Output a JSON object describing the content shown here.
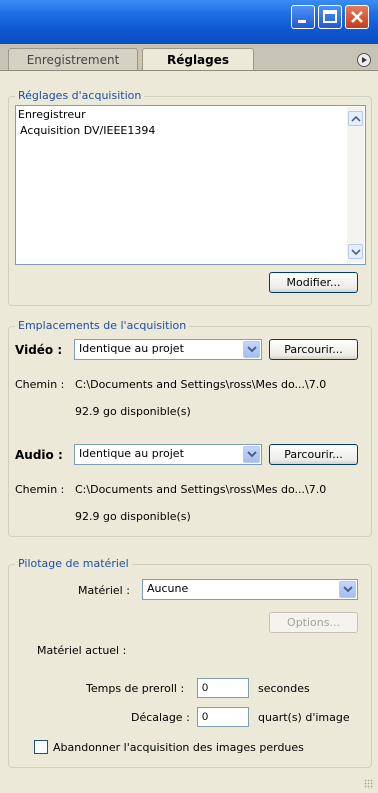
{
  "window": {
    "controls": {
      "minimize": "minimize-icon",
      "maximize": "maximize-icon",
      "close": "close-icon"
    }
  },
  "tabs": {
    "recording": "Enregistrement",
    "settings": "Réglages"
  },
  "capture_settings": {
    "legend": "Réglages d'acquisition",
    "list": [
      "Enregistreur",
      "Acquisition DV/IEEE1394"
    ],
    "modify_button": "Modifier..."
  },
  "capture_locations": {
    "legend": "Emplacements de l'acquisition",
    "video": {
      "label": "Vidéo :",
      "selected": "Identique au projet",
      "browse_button": "Parcourir...",
      "path_label": "Chemin :",
      "path": "C:\\Documents and Settings\\ross\\Mes do...\\7.0",
      "available": "92.9 go disponible(s)"
    },
    "audio": {
      "label": "Audio :",
      "selected": "Identique au projet",
      "browse_button": "Parcourir...",
      "path_label": "Chemin :",
      "path": "C:\\Documents and Settings\\ross\\Mes do...\\7.0",
      "available": "92.9 go disponible(s)"
    }
  },
  "device_control": {
    "legend": "Pilotage de matériel",
    "device_label": "Matériel :",
    "device_selected": "Aucune",
    "options_button": "Options...",
    "current_device_label": "Matériel actuel :",
    "preroll_label": "Temps de preroll :",
    "preroll_value": "0",
    "preroll_unit": "secondes",
    "offset_label": "Décalage :",
    "offset_value": "0",
    "offset_unit": "quart(s) d'image",
    "abort_label": "Abandonner l'acquisition des images perdues",
    "abort_checked": false
  }
}
